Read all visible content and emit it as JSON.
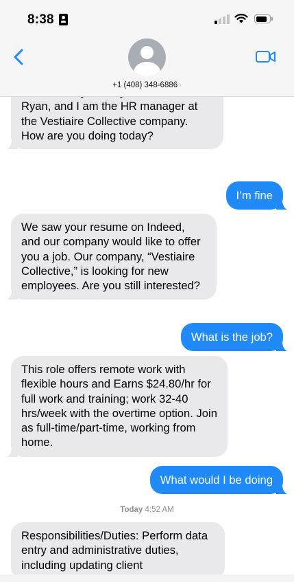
{
  "status_bar": {
    "time": "8:38",
    "signal_bars_active": 1,
    "battery_level_percent": 85
  },
  "header": {
    "contact": "+1 (408) 348-6886",
    "chevron": "›",
    "icons": [
      "back-chevron-icon",
      "avatar-placeholder-icon",
      "video-camera-icon"
    ]
  },
  "messages": [
    {
      "direction": "incoming",
      "text": "introduce myself. My name is Walter Ryan, and I am the HR manager at the Vestiaire Collective company. How are you doing today?"
    },
    {
      "direction": "outgoing",
      "text": "I’m fine"
    },
    {
      "direction": "incoming",
      "text": "We saw your resume on Indeed, and our company would like to offer you a job. Our company, “Vestiaire Collective,” is looking for new employees. Are you still interested?"
    },
    {
      "direction": "outgoing",
      "text": "What is the job?"
    },
    {
      "direction": "incoming",
      "text": "This role offers remote work with flexible hours and Earns $24.80/hr for full work and training; work 32-40 hrs/week with the overtime option. Join as full-time/part-time, working from home."
    },
    {
      "direction": "outgoing",
      "text": "What would I be doing"
    },
    {
      "direction": "incoming",
      "text": "Responsibilities/Duties: Perform data entry and administrative duties, including updating client"
    }
  ],
  "timestamp": {
    "day": "Today",
    "time": "4:52 AM"
  },
  "colors": {
    "outgoing_bubble": "#1f8af8",
    "incoming_bubble": "#e9e9eb",
    "accent": "#1f8af8",
    "header_background": "#f6f6f6"
  }
}
